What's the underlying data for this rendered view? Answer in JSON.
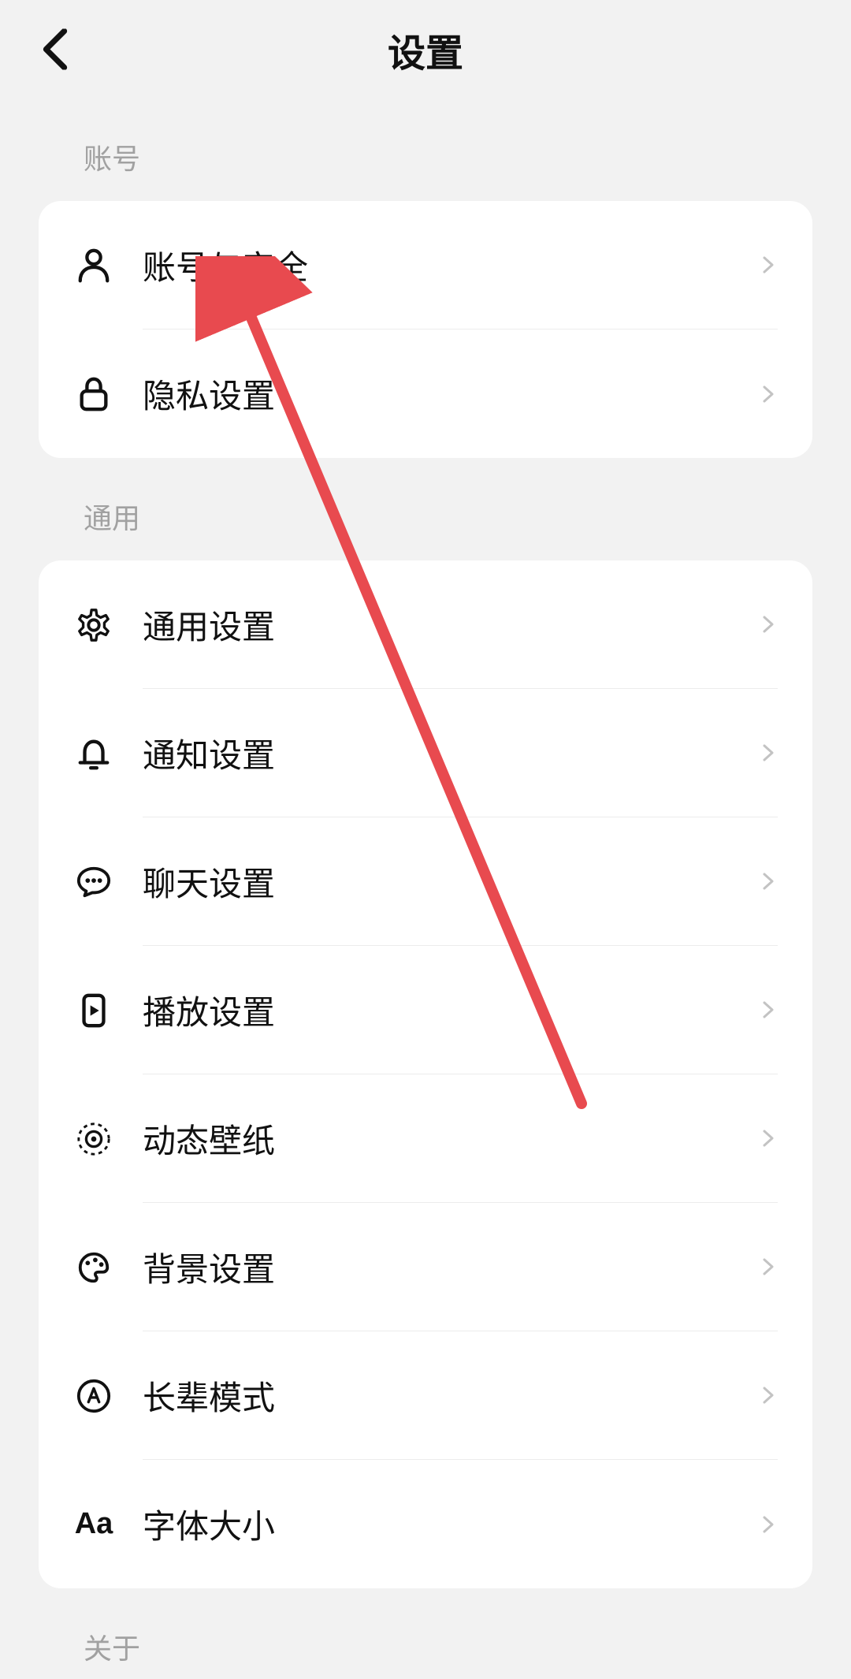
{
  "header": {
    "title": "设置"
  },
  "sections": [
    {
      "label": "账号",
      "items": [
        {
          "label": "账号与安全",
          "icon": "person-icon"
        },
        {
          "label": "隐私设置",
          "icon": "lock-icon"
        }
      ]
    },
    {
      "label": "通用",
      "items": [
        {
          "label": "通用设置",
          "icon": "gear-icon"
        },
        {
          "label": "通知设置",
          "icon": "bell-icon"
        },
        {
          "label": "聊天设置",
          "icon": "chat-icon"
        },
        {
          "label": "播放设置",
          "icon": "play-device-icon"
        },
        {
          "label": "动态壁纸",
          "icon": "wallpaper-icon"
        },
        {
          "label": "背景设置",
          "icon": "palette-icon"
        },
        {
          "label": "长辈模式",
          "icon": "circle-a-icon"
        },
        {
          "label": "字体大小",
          "icon": "font-aa-icon"
        }
      ]
    },
    {
      "label": "关于",
      "items": []
    }
  ],
  "annotation": {
    "arrow_color": "#e84a4f"
  }
}
